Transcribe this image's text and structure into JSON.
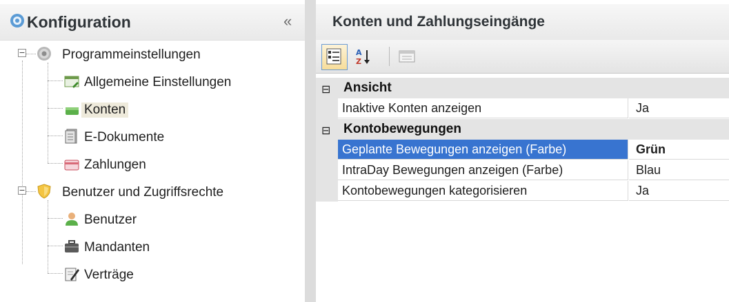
{
  "left_panel": {
    "title": "Konfiguration",
    "collapse_glyph": "«",
    "tree": {
      "group1": {
        "label": "Programmeinstellungen",
        "icon": "gear-icon",
        "expander": "−",
        "items": [
          {
            "label": "Allgemeine Einstellungen",
            "icon": "settings-window-icon"
          },
          {
            "label": "Konten",
            "icon": "account-card-icon",
            "selected": true
          },
          {
            "label": "E-Dokumente",
            "icon": "document-stack-icon"
          },
          {
            "label": "Zahlungen",
            "icon": "payment-card-icon"
          }
        ]
      },
      "group2": {
        "label": "Benutzer und Zugriffsrechte",
        "icon": "shield-icon",
        "expander": "−",
        "items": [
          {
            "label": "Benutzer",
            "icon": "user-icon"
          },
          {
            "label": "Mandanten",
            "icon": "briefcase-icon"
          },
          {
            "label": "Verträge",
            "icon": "contract-pen-icon"
          }
        ]
      }
    }
  },
  "right_panel": {
    "title": "Konten und Zahlungseingänge",
    "toolbar": [
      "categorized-view-icon",
      "sort-alphabetical-icon",
      "property-pages-icon"
    ],
    "categories": [
      {
        "name": "Ansicht",
        "expander": "⊟",
        "properties": [
          {
            "name": "Inaktive Konten anzeigen",
            "value": "Ja"
          }
        ]
      },
      {
        "name": "Kontobewegungen",
        "expander": "⊟",
        "properties": [
          {
            "name": "Geplante Bewegungen anzeigen (Farbe)",
            "value": "Grün",
            "selected": true
          },
          {
            "name": "IntraDay Bewegungen anzeigen (Farbe)",
            "value": "Blau"
          },
          {
            "name": "Kontobewegungen kategorisieren",
            "value": "Ja"
          }
        ]
      }
    ]
  },
  "colors": {
    "selection": "#3874d0",
    "tree_selection": "#eeeadb",
    "header_bg": "#eeeeee",
    "category_bg": "#e4e4e4"
  }
}
